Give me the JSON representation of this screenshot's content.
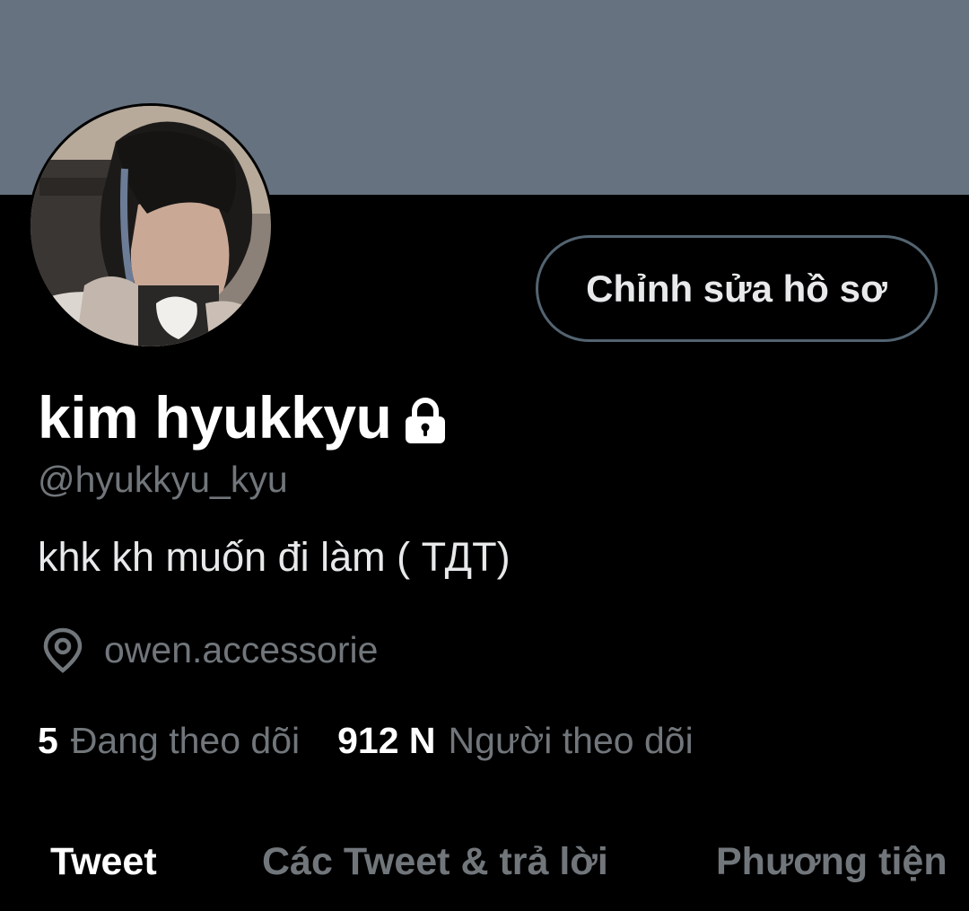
{
  "profile": {
    "display_name": "kim hyukkyu",
    "handle": "@hyukkyu_kyu",
    "bio": "khk kh muốn đi làm ( ТДТ)",
    "location": "owen.accessorie",
    "protected_icon": "lock-icon",
    "location_icon": "map-pin-icon",
    "edit_button_label": "Chỉnh sửa hồ sơ"
  },
  "stats": {
    "following_count": "5",
    "following_label": "Đang theo dõi",
    "followers_count": "912 N",
    "followers_label": "Người theo dõi"
  },
  "tabs": [
    {
      "label": "Tweet",
      "active": true
    },
    {
      "label": "Các Tweet & trả lời",
      "active": false
    },
    {
      "label": "Phương tiện",
      "active": false
    }
  ],
  "colors": {
    "banner": "#66727f",
    "background": "#000000",
    "text_primary": "#ffffff",
    "text_secondary": "#71767b",
    "button_border": "#536471"
  }
}
